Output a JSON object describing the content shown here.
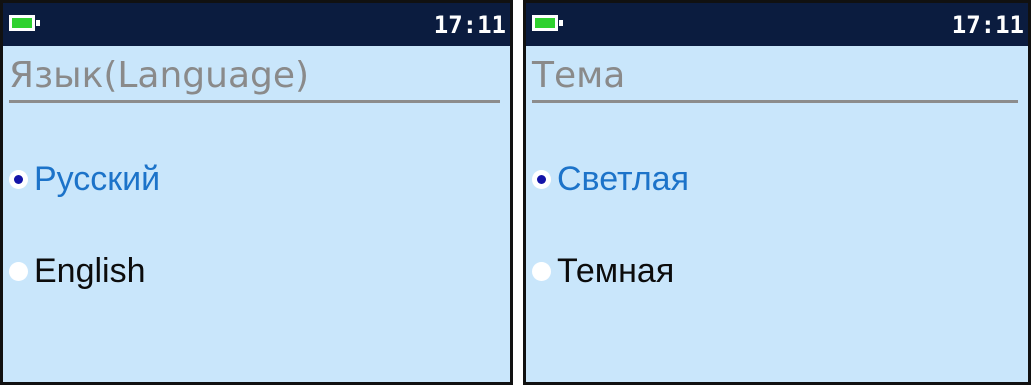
{
  "screens": [
    {
      "status": {
        "time": "17:11",
        "battery_level": 1.0
      },
      "title": "Язык(Language)",
      "options": [
        {
          "label": "Русский",
          "selected": true
        },
        {
          "label": "English",
          "selected": false
        }
      ]
    },
    {
      "status": {
        "time": "17:11",
        "battery_level": 1.0
      },
      "title": "Тема",
      "options": [
        {
          "label": "Светлая",
          "selected": true
        },
        {
          "label": "Темная",
          "selected": false
        }
      ]
    }
  ],
  "colors": {
    "screen_background": "#c9e6fb",
    "statusbar_background": "#0b1c3f",
    "battery_fill": "#2fd12f",
    "selected_text": "#1c73c9",
    "unselected_text": "#0c0c0c",
    "radio_dot": "#1414a8",
    "title_text": "#8a8a8a"
  }
}
